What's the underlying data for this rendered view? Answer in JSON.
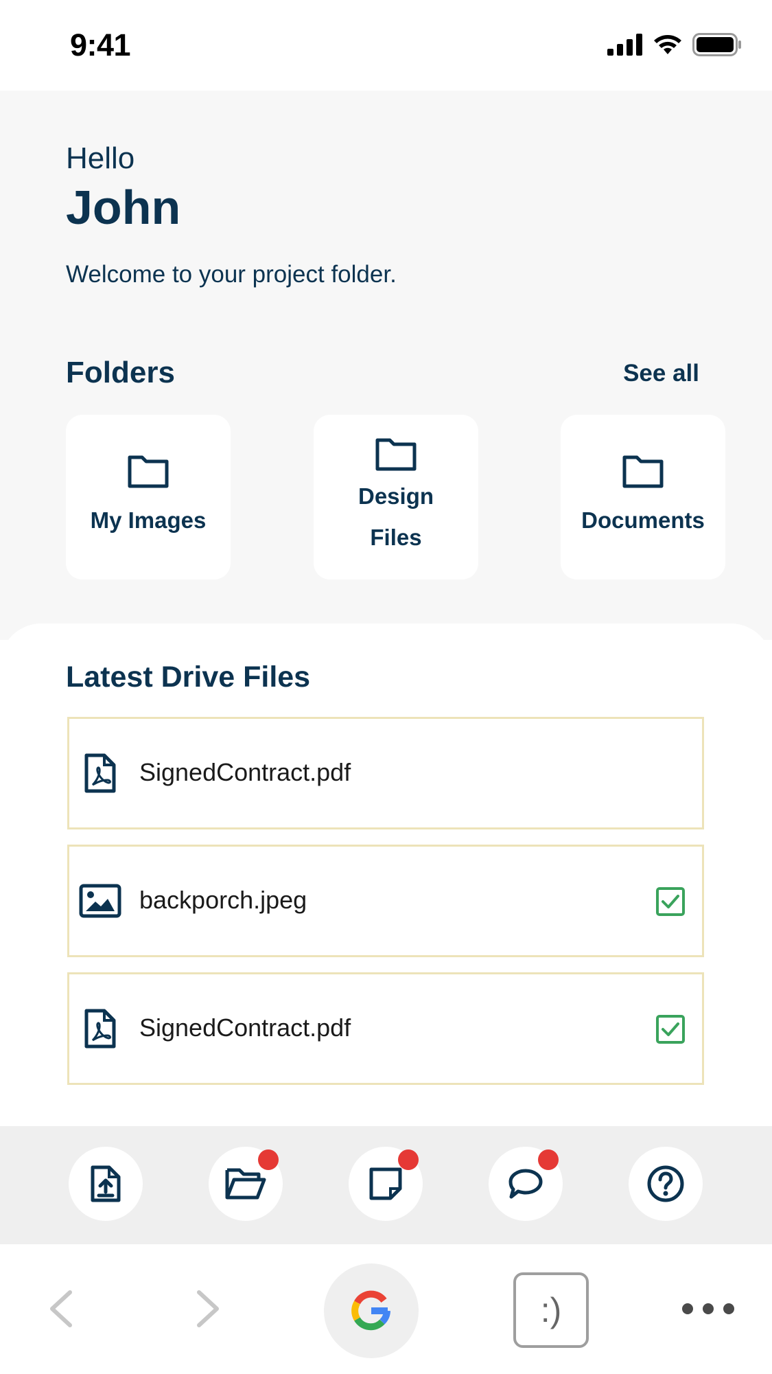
{
  "status_bar": {
    "time": "9:41"
  },
  "header": {
    "greeting": "Hello",
    "username": "John",
    "welcome": "Welcome to your project folder."
  },
  "folders": {
    "title": "Folders",
    "see_all": "See all",
    "items": [
      {
        "label": "My Images",
        "icon": "folder-icon"
      },
      {
        "label": "Design Files",
        "icon": "folder-icon"
      },
      {
        "label": "Documents",
        "icon": "folder-icon"
      }
    ]
  },
  "files": {
    "title": "Latest Drive Files",
    "items": [
      {
        "name": "SignedContract.pdf",
        "icon": "pdf-file-icon",
        "checked": false
      },
      {
        "name": "backporch.jpeg",
        "icon": "image-file-icon",
        "checked": true
      },
      {
        "name": "SignedContract.pdf",
        "icon": "pdf-file-icon",
        "checked": true
      }
    ]
  },
  "action_bar": {
    "items": [
      {
        "icon": "upload-file-icon",
        "badge": false
      },
      {
        "icon": "open-folder-icon",
        "badge": true
      },
      {
        "icon": "note-icon",
        "badge": true
      },
      {
        "icon": "chat-icon",
        "badge": true
      },
      {
        "icon": "help-icon",
        "badge": false
      }
    ]
  },
  "browser_bar": {
    "tab_label": ":)"
  },
  "colors": {
    "primary": "#0c3350",
    "header_bg": "#f7f7f7",
    "file_border": "#ede3b9",
    "check_green": "#3aa35c",
    "badge_red": "#e53935"
  }
}
